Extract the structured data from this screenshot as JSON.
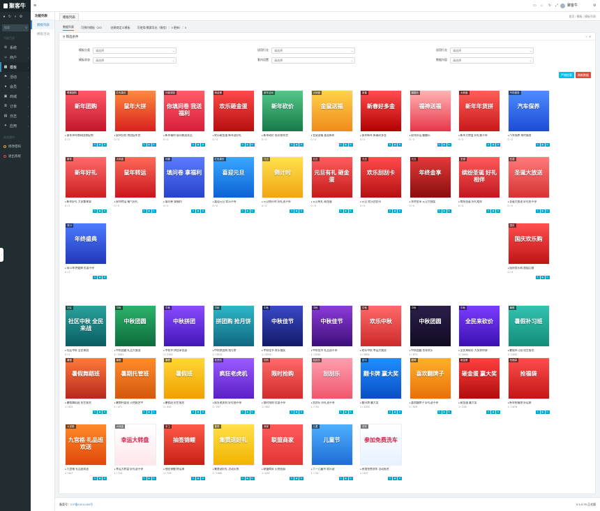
{
  "brand": {
    "name": "聚客牛"
  },
  "sidebar": {
    "search_placeholder": "搜索",
    "nav_header": "功能目录",
    "items": [
      {
        "label": "系统",
        "icon": "gear-icon"
      },
      {
        "label": "商户",
        "icon": "users-icon"
      },
      {
        "label": "模板",
        "icon": "grid-icon",
        "active": true
      },
      {
        "label": "活动",
        "icon": "flag-icon"
      },
      {
        "label": "会员",
        "icon": "user-icon"
      },
      {
        "label": "商城",
        "icon": "cart-icon"
      },
      {
        "label": "订单",
        "icon": "list-icon"
      },
      {
        "label": "日志",
        "icon": "file-icon"
      },
      {
        "label": "应用",
        "icon": "apps-icon"
      }
    ],
    "other_header": "其他操作",
    "extra": [
      {
        "label": "修改密码",
        "color": "#e8a33d"
      },
      {
        "label": "退出系统",
        "color": "#dd4b39"
      }
    ]
  },
  "header": {
    "username": "聚客牛"
  },
  "col2": {
    "title": "功能列表",
    "items": [
      {
        "label": "模板列表",
        "active": true
      },
      {
        "label": "模板活动"
      }
    ]
  },
  "tabstrip": {
    "tab": "模板列表",
    "breadcrumb": "首页 / 模板 / 模板列表"
  },
  "filter_tabs": [
    "数据列表",
    "可预约模板（20）",
    "创建商定义模板",
    "可使用/需要导出（微信）：0 更新）：0"
  ],
  "search": {
    "title": "筛选条件",
    "fields": [
      {
        "label": "模板分类",
        "value": "请选择"
      },
      {
        "label": "适用行业",
        "value": "请选择"
      },
      {
        "label": "适用行业",
        "value": "请选择"
      },
      {
        "label": "模板状态",
        "value": "请选择"
      },
      {
        "label": "套内设置",
        "value": "请选择"
      },
      {
        "label": "数据内容",
        "value": "请选择"
      }
    ],
    "buttons": [
      {
        "label": "严格检索",
        "color": "#00c0ef"
      },
      {
        "label": "刷新数据",
        "color": "#dd4b39"
      }
    ]
  },
  "cards": [
    {
      "badge": "联赛团购",
      "title": "新年团购",
      "caption": "鼠年拜年期间团购促销",
      "stats": "0 / 0",
      "bg": "linear-gradient(#ff5a6a,#c2162a)"
    },
    {
      "badge": "红色喜庆",
      "title": "鼠年大拼",
      "caption": "鼠年狂欢 拼团促年货",
      "stats": "0 / 0",
      "bg": "linear-gradient(#ff8a3d,#d8201f)"
    },
    {
      "badge": "问卷调查",
      "title": "你填问卷 我送福利",
      "caption": "新年福利 填问卷送奖品",
      "stats": "0 / 0",
      "bg": "linear-gradient(#ff5c69,#d81e3a)"
    },
    {
      "badge": "砸金蛋",
      "title": "欢乐砸金蛋",
      "caption": "欢乐砸金蛋 新年送好礼",
      "stats": "0 / 0",
      "bg": "linear-gradient(#ff4a4a,#b60e0e)"
    },
    {
      "badge": "新年活动",
      "title": "新年砍价",
      "caption": "新年砍价 低价抢年货",
      "stats": "0 / 0",
      "bg": "linear-gradient(#54c78a,#177a48)"
    },
    {
      "badge": "大转盘",
      "title": "金鼠送福",
      "caption": "金鼠送福 喜迎新年",
      "stats": "0 / 0",
      "bg": "linear-gradient(#ffd24a,#f08a1a)"
    },
    {
      "badge": "新春",
      "title": "新春好多金",
      "caption": "鼠年新年 新春好多金",
      "stats": "0 / 0",
      "bg": "linear-gradient(#ff4d4d,#b30000)"
    },
    {
      "badge": "翻翻乐",
      "title": "福神送福",
      "caption": "鼠年好运 翻翻乐",
      "stats": "0 / 0",
      "bg": "linear-gradient(#ffb3b3,#e7374a)"
    },
    {
      "badge": "大转盘",
      "title": "新年年货拼",
      "caption": "新年大转盘 好礼抽不停",
      "stats": "0 / 0",
      "bg": "linear-gradient(#ff5e57,#c8181a)"
    },
    {
      "badge": "汽车服务",
      "title": "汽车保养",
      "caption": "汽车保养 预约服务",
      "stats": "0 / 0",
      "bg": "linear-gradient(#4d8cff,#1c4bd4)"
    },
    {
      "badge": "新年",
      "title": "新年好礼",
      "caption": "新年好礼 大家都来拿",
      "stats": "0 / 0",
      "bg": "linear-gradient(#ff6b6b,#cc1f1f)"
    },
    {
      "badge": "大转盘",
      "title": "鼠年转运",
      "caption": "鼠年转运 福气好礼",
      "stats": "0 / 0",
      "bg": "linear-gradient(#ff6a5a,#c9151c)"
    },
    {
      "badge": "问卷",
      "title": "填问卷 拿福利",
      "caption": "填问卷 拿福利",
      "stats": "0 / 0",
      "bg": "linear-gradient(#5b7bff,#2743c9)"
    },
    {
      "badge": "红色喜庆",
      "title": "喜迎元旦",
      "caption": "喜迎元旦 欢乐不停",
      "stats": "0 / 0",
      "bg": "linear-gradient(#3aa7ff,#0c63d4)"
    },
    {
      "badge": "元旦",
      "title": "倒计时",
      "caption": "元旦倒计时 好礼送不停",
      "stats": "0 / 0",
      "bg": "linear-gradient(#ffe14f,#f0a612)"
    },
    {
      "badge": "元旦",
      "title": "元旦有礼 砸金蛋",
      "caption": "元旦有礼 砸金蛋",
      "stats": "0 / 0",
      "bg": "linear-gradient(#ff5d5d,#c51a1a)"
    },
    {
      "badge": "元旦",
      "title": "欢乐刮刮卡",
      "caption": "元旦 欢乐刮刮卡",
      "stats": "0 / 0",
      "bg": "linear-gradient(#ff4b4b,#b41010)"
    },
    {
      "badge": "元旦",
      "title": "年终金享",
      "caption": "年终金享 元旦大抽奖",
      "stats": "0 / 0",
      "bg": "linear-gradient(#e33a3a,#8a0d0d)"
    },
    {
      "badge": "圣诞",
      "title": "缤纷圣诞 好礼相伴",
      "caption": "缤纷圣诞 好礼相伴",
      "stats": "0 / 0",
      "bg": "linear-gradient(#ff5a5a,#c0181f)"
    },
    {
      "badge": "圣诞",
      "title": "圣诞大放送",
      "caption": "圣诞大放送 好礼抢不停",
      "stats": "0 / 0",
      "bg": "linear-gradient(#ff7a7a,#d63333)"
    },
    {
      "badge": "双12",
      "title": "年终盛典",
      "caption": "双12年终盛典 优惠不停",
      "stats": "0 / 0",
      "bg": "linear-gradient(#4d7cff,#2037b8)"
    },
    {
      "badge": "国庆",
      "title": "国庆欢乐购",
      "caption": "国庆欢乐购 超值巨献",
      "stats": "0 / 0",
      "bg": "linear-gradient(#ff4f4f,#c01414)"
    },
    {
      "badge": "社区",
      "title": "社区中秋 全民来战",
      "caption": "社区中秋 全民来战",
      "stats": "0 / 0",
      "bg": "linear-gradient(#2aa39a,#0a5b62)"
    },
    {
      "badge": "中秋",
      "title": "中秋团圆",
      "caption": "中秋团圆 礼品大放送",
      "stats": "1 / 3281",
      "bg": "linear-gradient(#2cb36b,#0d6b3b)"
    },
    {
      "badge": "中秋",
      "title": "中秋拼团",
      "caption": "中秋节 拼团享优惠",
      "stats": "1 / 2341",
      "bg": "linear-gradient(#8a4bff,#4316b7)"
    },
    {
      "badge": "中秋",
      "title": "拼团购 抢月饼",
      "caption": "中秋拼团购 抢月饼",
      "stats": "1 / 3013",
      "bg": "linear-gradient(#2fb7c9,#0f6780)"
    },
    {
      "badge": "中秋",
      "title": "中秋佳节",
      "caption": "中秋佳节 欢乐抽奖",
      "stats": "1 / 3215",
      "bg": "linear-gradient(#3a49c8,#111a66)"
    },
    {
      "badge": "中秋",
      "title": "中秋佳节",
      "caption": "中秋佳节 礼品送不停",
      "stats": "1 / 2190",
      "bg": "linear-gradient(#8c3cd9,#3d0e7a)"
    },
    {
      "badge": "中秋",
      "title": "欢乐中秋",
      "caption": "欢乐中秋 幸运大抽奖",
      "stats": "1 / 2891",
      "bg": "linear-gradient(#ff6a6a,#cc2a2a)"
    },
    {
      "badge": "中秋",
      "title": "中秋团圆",
      "caption": "中秋团圆 合家欢乐",
      "stats": "1 / 872",
      "bg": "linear-gradient(#2b1f4a,#120a22)"
    },
    {
      "badge": "中秋",
      "title": "全民来砍价",
      "caption": "全民来砍价 大奖等你拿",
      "stats": "1 / 1644",
      "bg": "linear-gradient(#7a3cff,#3c10b0)"
    },
    {
      "badge": "暑假",
      "title": "暑假补习班",
      "caption": "暑假补习班 招生报名",
      "stats": "1 / 1632",
      "bg": "linear-gradient(#33c3b0,#138d7a)"
    },
    {
      "badge": "暑假",
      "title": "暑假舞蹈班",
      "caption": "暑假舞蹈班 招生报名",
      "stats": "1 / 821",
      "bg": "linear-gradient(#ff7a3a,#b6281f)"
    },
    {
      "badge": "暑假",
      "title": "暑期托管班",
      "caption": "暑期托管班 火热报名中",
      "stats": "1 / 471",
      "bg": "linear-gradient(#ff8c2a,#d4580d)"
    },
    {
      "badge": "暑假",
      "title": "暑假班",
      "caption": "暑假班 招生报名",
      "stats": "1 / 492",
      "bg": "linear-gradient(#ffd735,#f0a000)"
    },
    {
      "badge": "老虎机",
      "title": "疯狂老虎机",
      "caption": "疯狂老虎机 好礼抽不停",
      "stats": "1 / 297",
      "bg": "linear-gradient(#9b5cff,#5a1fc6)"
    },
    {
      "badge": "抢购",
      "title": "限时抢购",
      "caption": "限时抢购 优惠不停",
      "stats": "1 / 562",
      "bg": "linear-gradient(#ff6b6b,#d12b2b)"
    },
    {
      "badge": "刮刮乐",
      "title": "刮刮乐",
      "caption": "刮刮乐 好礼送不停",
      "stats": "1 / 731",
      "bg": "linear-gradient(#ff9fb0,#f0566d)"
    },
    {
      "badge": "刮卡",
      "title": "翻卡牌 赢大奖",
      "caption": "翻卡牌 赢大奖",
      "stats": "1 / 1200",
      "bg": "linear-gradient(#1f8fff,#0a4ec4)"
    },
    {
      "badge": "翻牌",
      "title": "喜欢翻牌子",
      "caption": "喜欢翻牌子 好礼送不停",
      "stats": "1 / 529",
      "bg": "linear-gradient(#ffb12a,#e8700a)"
    },
    {
      "badge": "砸金蛋",
      "title": "砸金蛋 赢大奖",
      "caption": "砸金蛋 赢大奖",
      "stats": "1 / 238",
      "bg": "linear-gradient(#ff4040,#b00d0d)"
    },
    {
      "badge": "抢福袋",
      "title": "抢福袋",
      "caption": "新年抢福袋 好运来",
      "stats": "1 / 1678",
      "bg": "linear-gradient(#ff4d4d,#c31616)"
    },
    {
      "badge": "九宫格",
      "title": "九宫格 礼品班欢送",
      "caption": "九宫格 礼品班欢送",
      "stats": "1 / 827",
      "bg": "linear-gradient(#ff8a2a,#e0480a)"
    },
    {
      "badge": "大转盘",
      "title": "幸运大转盘",
      "caption": "幸运大转盘 好礼送不停",
      "stats": "1 / 714",
      "bg": "linear-gradient(#ffffff,#ffe6ec)",
      "dark": true
    },
    {
      "badge": "手工",
      "title": "抽签锦鲤",
      "caption": "抽签锦鲤 转运来",
      "stats": "1 / 725",
      "bg": "linear-gradient(#ff5a4a,#c81f14)"
    },
    {
      "badge": "集赞",
      "title": "集赞送好礼",
      "caption": "集赞送好礼 活动火热",
      "stats": "1 / 1080",
      "bg": "linear-gradient(#ffe14a,#f2b300)"
    },
    {
      "badge": "商家",
      "title": "联盟商家",
      "caption": "联盟商家 火热招募",
      "stats": "1 / 632",
      "bg": "linear-gradient(#ff5a5a,#e23636)"
    },
    {
      "badge": "儿童",
      "title": "儿童节",
      "caption": "六一儿童节 欢乐送",
      "stats": "1 / 711",
      "bg": "linear-gradient(#4fb0ff,#1f6dd6)"
    },
    {
      "badge": "洗车",
      "title": "参加免费洗车",
      "caption": "参加免费洗车 活动报名",
      "stats": "1 / 627",
      "bg": "linear-gradient(#ffffff,#e6f2ff)",
      "dark": true
    }
  ],
  "footer": {
    "prefix": "备案号：",
    "icp": "ICP备16011465号",
    "version": "V 1.0.79 正式版"
  }
}
